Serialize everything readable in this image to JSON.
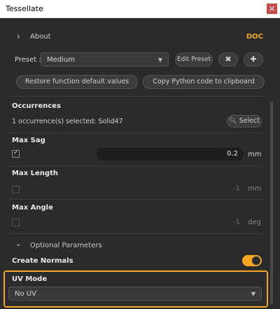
{
  "window": {
    "title": "Tessellate",
    "close_glyph": "×"
  },
  "about": {
    "label": "About",
    "doc_label": "DOC"
  },
  "preset": {
    "label": "Preset :",
    "value": "Medium",
    "edit_label": "Edit Preset",
    "delete_glyph": "✖",
    "add_glyph": "✚"
  },
  "actions": {
    "restore_label": "Restore function default values",
    "copy_label": "Copy Python code to clipboard"
  },
  "occurrences": {
    "title": "Occurrences",
    "status": "1 occurrence(s) selected: Solid47",
    "select_label": "Select",
    "select_icon": "search-icon"
  },
  "max_sag": {
    "title": "Max Sag",
    "checked": true,
    "value": "0.2",
    "unit": "mm"
  },
  "max_length": {
    "title": "Max Length",
    "checked": false,
    "value": "-1",
    "unit": "mm"
  },
  "max_angle": {
    "title": "Max Angle",
    "checked": false,
    "value": "-1",
    "unit": "deg"
  },
  "optional": {
    "label": "Optional Parameters"
  },
  "create_normals": {
    "title": "Create Normals",
    "enabled": true
  },
  "uv_mode": {
    "title": "UV Mode",
    "value": "No UV"
  },
  "colors": {
    "accent": "#f2a623",
    "panel_bg": "#2b2b2b",
    "field_bg": "#1e1e1e",
    "close_red": "#c94a4a"
  }
}
